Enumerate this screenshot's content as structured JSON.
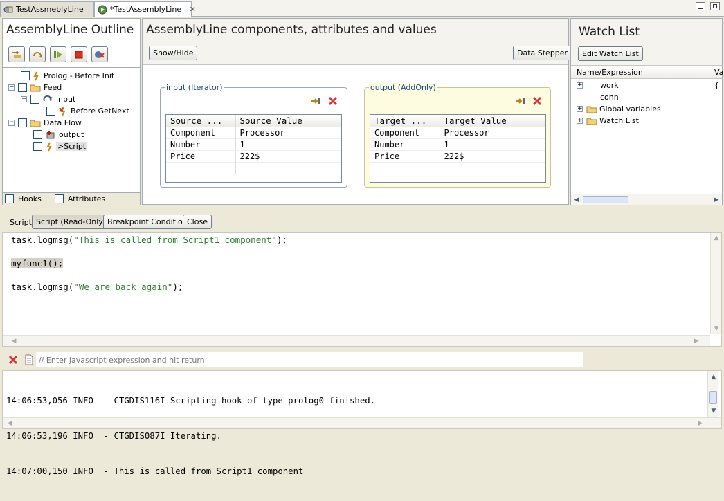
{
  "tabs": [
    {
      "label": "TestAssmeblyLine",
      "active": false
    },
    {
      "label": "*TestAssemblyLine",
      "active": true
    }
  ],
  "outline": {
    "title": "AssemblyLine Outline",
    "toolbar": [
      "step-into-icon",
      "reload-icon",
      "run-icon",
      "stop-icon",
      "remove-breakpoints-icon"
    ],
    "tree": [
      {
        "label": "Prolog - Before Init"
      },
      {
        "label": "Feed"
      },
      {
        "label": "input"
      },
      {
        "label": "Before GetNext"
      },
      {
        "label": "Data Flow"
      },
      {
        "label": "output"
      },
      {
        "label": ">Script"
      }
    ],
    "hooks_label": "Hooks",
    "attributes_label": "Attributes"
  },
  "components": {
    "title": "AssemblyLine components, attributes and values",
    "show_hide": "Show/Hide",
    "data_stepper": "Data Stepper",
    "input": {
      "label": "input (Iterator)",
      "headers": [
        "Source ...",
        "Source Value"
      ],
      "rows": [
        [
          "Component",
          "Processor"
        ],
        [
          "Number",
          "1"
        ],
        [
          "Price",
          "222$"
        ],
        [
          "",
          ""
        ]
      ]
    },
    "output": {
      "label": "output (AddOnly)",
      "headers": [
        "Target ...",
        "Target Value"
      ],
      "rows": [
        [
          "Component",
          "Processor"
        ],
        [
          "Number",
          "1"
        ],
        [
          "Price",
          "222$"
        ],
        [
          "",
          ""
        ]
      ]
    }
  },
  "watch": {
    "title": "Watch List",
    "edit_button": "Edit Watch List",
    "col_name": "Name/Expression",
    "col_value": "Va",
    "items": [
      {
        "label": "work",
        "value": "{"
      },
      {
        "label": "conn",
        "value": ""
      },
      {
        "label": "Global variables",
        "value": ""
      },
      {
        "label": "Watch List",
        "value": ""
      }
    ]
  },
  "script_bar": {
    "label": "Script",
    "readonly": "Script (Read-Only)",
    "breakpoint": "Breakpoint Condition",
    "close": "Close"
  },
  "code": {
    "line1_pre": "task.logmsg(",
    "line1_str": "\"This is called from Script1 component\"",
    "line1_post": ");",
    "line2": "myfunc1();",
    "line3_pre": "task.logmsg(",
    "line3_str": "\"We are back again\"",
    "line3_post": ");"
  },
  "console": {
    "placeholder": "// Enter javascript expression and hit return",
    "lines": [
      "14:06:53,056 INFO  - CTGDIS116I Scripting hook of type prolog0 finished.",
      "14:06:53,196 INFO  - CTGDIS087I Iterating.",
      "14:07:00,150 INFO  - This is called from Script1 component"
    ]
  },
  "colors": {
    "string": "#2a7d2a",
    "group_border": "#9aa8b9",
    "output_bg": "#fdfbe0"
  }
}
